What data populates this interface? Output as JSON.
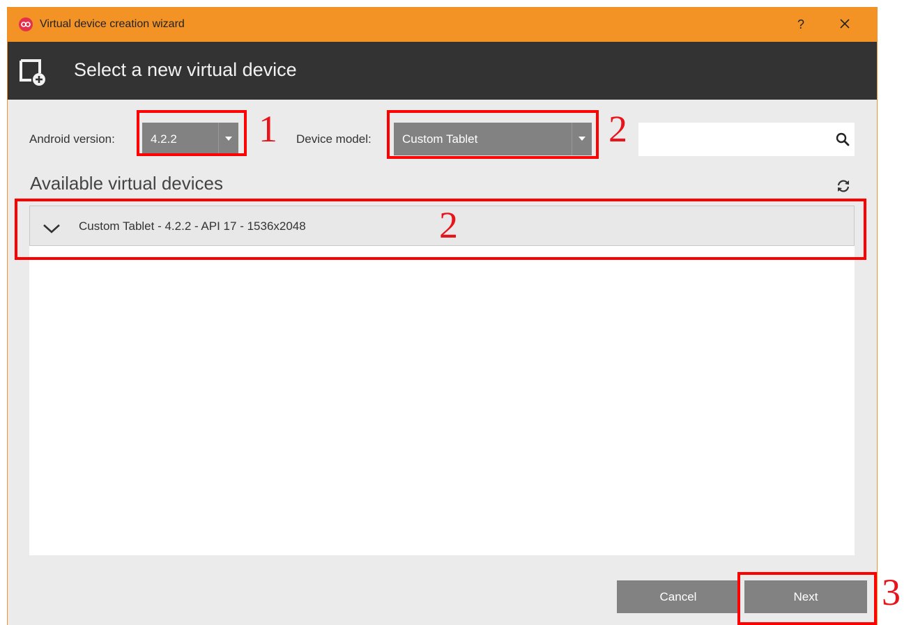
{
  "window": {
    "title": "Virtual device creation wizard",
    "help_label": "?",
    "accent_color": "#f39325"
  },
  "header": {
    "title": "Select a new virtual device"
  },
  "filters": {
    "android_version_label": "Android version:",
    "android_version_value": "4.2.2",
    "device_model_label": "Device model:",
    "device_model_value": "Custom Tablet",
    "search_value": ""
  },
  "devices": {
    "section_title": "Available virtual devices",
    "items": [
      {
        "label": "Custom Tablet - 4.2.2 - API 17 - 1536x2048"
      }
    ]
  },
  "footer": {
    "cancel_label": "Cancel",
    "next_label": "Next"
  },
  "annotations": {
    "marker_1": "1",
    "marker_2a": "2",
    "marker_2b": "2",
    "marker_3": "3",
    "color": "#ff0000"
  }
}
